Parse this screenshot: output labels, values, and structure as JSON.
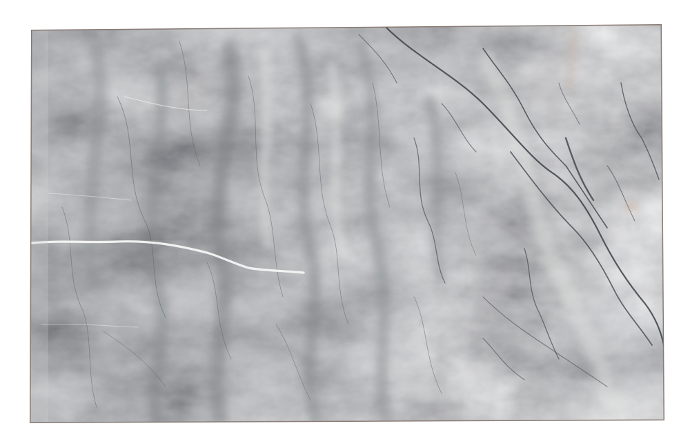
{
  "image": {
    "subject": "marble-slab",
    "colors": {
      "background": "#ffffff",
      "slab_base": "#b9bcbc",
      "slab_light": "#e4e5e3",
      "slab_mid": "#a6aaab",
      "slab_dark": "#7c8183",
      "vein_dark": "#3c4148",
      "vein_light": "#f4f4f2",
      "rust_tint": "#b99780",
      "edge": "#8d7a70"
    }
  }
}
